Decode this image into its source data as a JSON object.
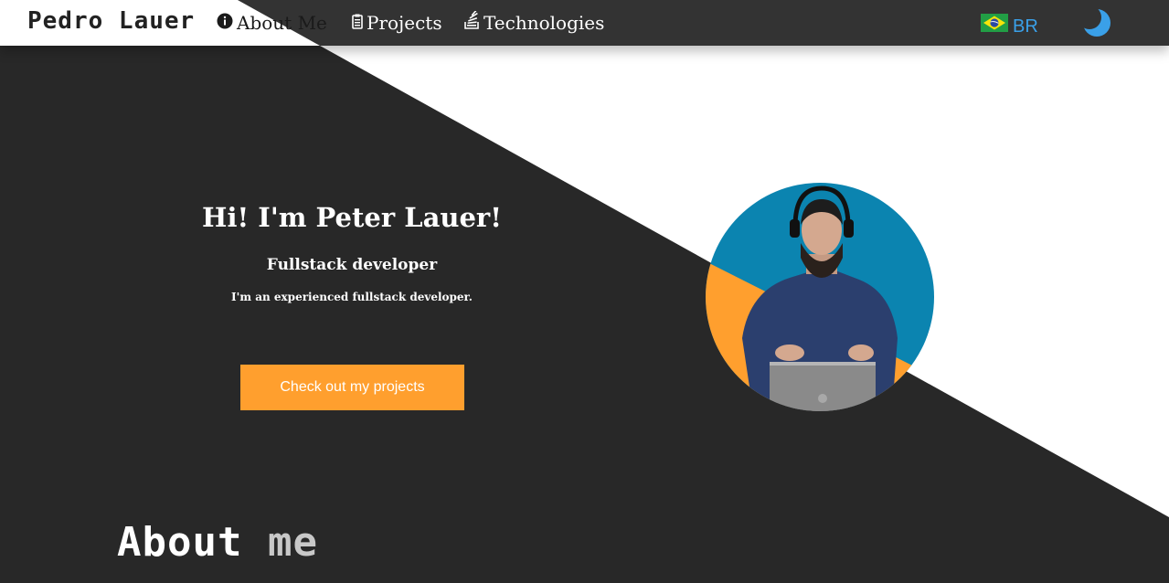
{
  "nav": {
    "brand": "Pedro Lauer",
    "items": [
      {
        "label": "About Me",
        "icon": "info-icon"
      },
      {
        "label": "Projects",
        "icon": "clipboard-list-icon"
      },
      {
        "label": "Technologies",
        "icon": "stack-icon"
      }
    ],
    "language": {
      "label": "BR",
      "icon": "brazil-flag-icon"
    },
    "theme_icon": "moon-icon"
  },
  "hero": {
    "title": "Hi! I'm Peter Lauer!",
    "subtitle": "Fullstack developer",
    "description": "I'm an experienced fullstack developer.",
    "cta_label": "Check out my projects"
  },
  "about": {
    "title_part1": "About",
    "title_part2": "me"
  },
  "colors": {
    "dark": "#282828",
    "light": "#ffffff",
    "accent": "#ff9f2e",
    "link": "#3aa0e8",
    "avatar_blue": "#0b84b0"
  }
}
